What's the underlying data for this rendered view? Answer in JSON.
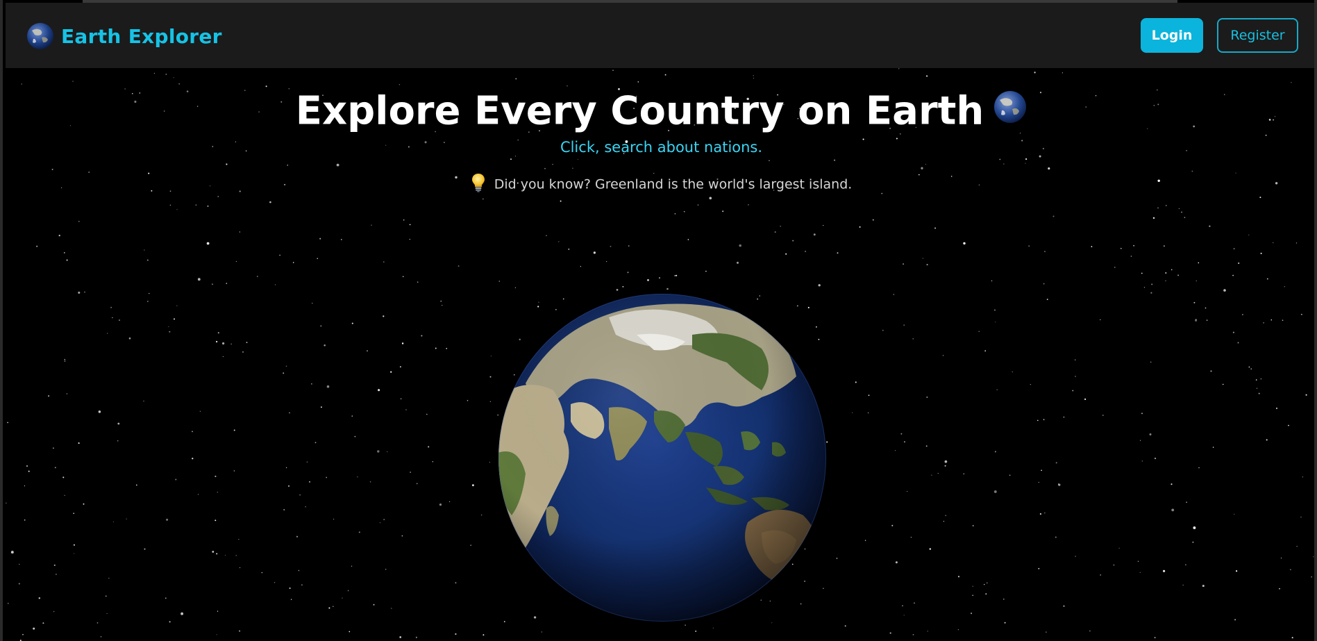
{
  "navbar": {
    "brand": "Earth Explorer",
    "login_label": "Login",
    "register_label": "Register"
  },
  "hero": {
    "title": "Explore Every Country on Earth",
    "subtitle": "Click, search about nations.",
    "fact": "Did you know? Greenland is the world's largest island."
  },
  "icons": {
    "brand": "globe-icon",
    "title": "globe-icon",
    "fact": "lightbulb-icon"
  },
  "colors": {
    "accent": "#16c3e6",
    "login_bg": "#0bb4dc",
    "navbar_bg": "#1b1b1b",
    "background": "#000000",
    "ocean": "#12306f"
  }
}
